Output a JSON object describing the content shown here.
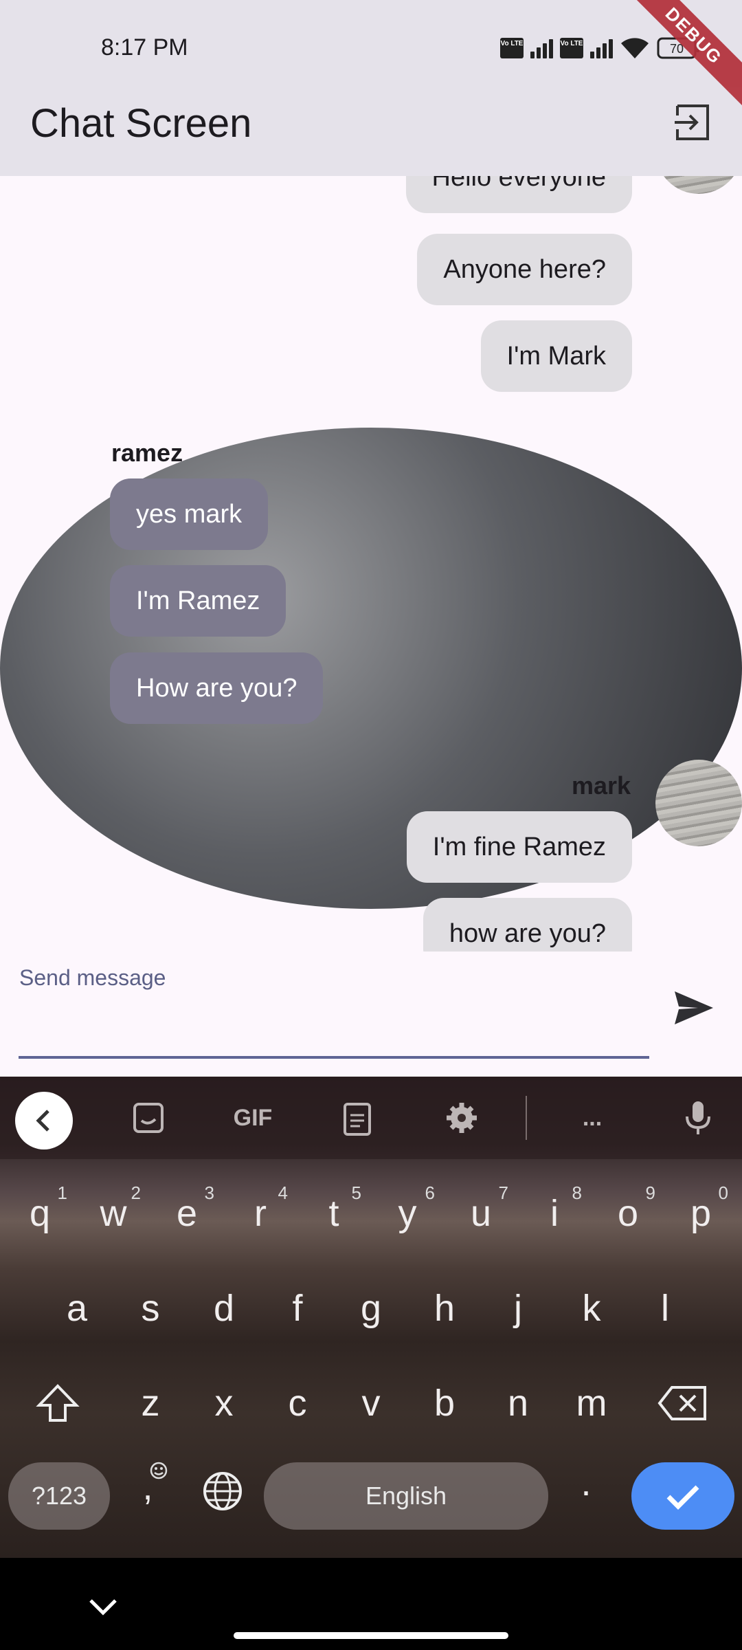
{
  "status_bar": {
    "time": "8:17 PM",
    "volte_label": "Vo LTE",
    "battery": "70"
  },
  "app_bar": {
    "title": "Chat Screen",
    "debug_label": "DEBUG"
  },
  "messages": {
    "m1": "Hello everyone",
    "m2": "Anyone here?",
    "m3": "I'm Mark",
    "ramez_name": "ramez",
    "r1": "yes mark",
    "r2": "I'm Ramez",
    "r3": "How are you?",
    "mark_name": "mark",
    "m4": "I'm fine Ramez",
    "m5": "how are you?"
  },
  "input": {
    "placeholder": "Send message"
  },
  "keyboard": {
    "row1": [
      "q",
      "w",
      "e",
      "r",
      "t",
      "y",
      "u",
      "i",
      "o",
      "p"
    ],
    "row1_nums": [
      "1",
      "2",
      "3",
      "4",
      "5",
      "6",
      "7",
      "8",
      "9",
      "0"
    ],
    "row2": [
      "a",
      "s",
      "d",
      "f",
      "g",
      "h",
      "j",
      "k",
      "l"
    ],
    "row3": [
      "z",
      "x",
      "c",
      "v",
      "b",
      "n",
      "m"
    ],
    "symbols_label": "?123",
    "comma": ",",
    "space_label": "English",
    "period": ".",
    "gif_label": "GIF",
    "more_label": "..."
  },
  "colors": {
    "appbar": "#e5e2ea",
    "my_bubble": "#e0dee2",
    "other_bubble": "#7d7a8e",
    "accent": "#4d8df5"
  }
}
